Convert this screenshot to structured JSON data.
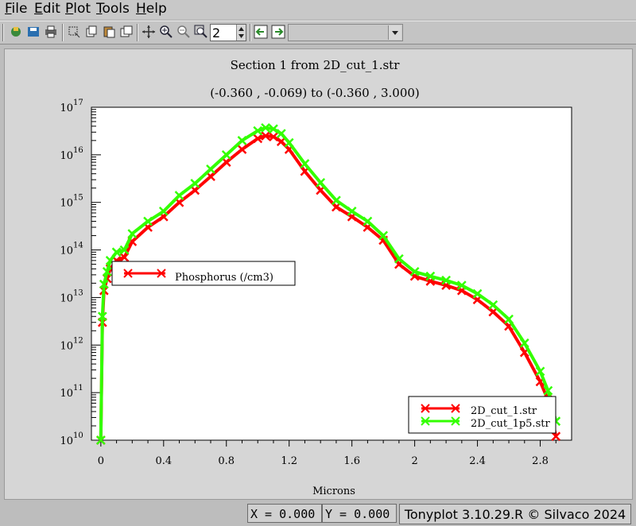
{
  "menu": {
    "file": {
      "key": "F",
      "rest": "ile"
    },
    "edit": {
      "key": "E",
      "rest": "dit"
    },
    "plot": {
      "key": "P",
      "rest": "lot"
    },
    "tools": {
      "key": "T",
      "rest": "ools"
    },
    "help": {
      "key": "H",
      "rest": "elp"
    }
  },
  "toolbar": {
    "spin_value": "2",
    "combo_value": ""
  },
  "plot": {
    "title": "Section 1 from 2D_cut_1.str",
    "subtitle": "(-0.360 , -0.069) to (-0.360 , 3.000)",
    "xlabel": "Microns",
    "x_ticks": [
      "0",
      "0.4",
      "0.8",
      "1.2",
      "1.6",
      "2",
      "2.4",
      "2.8"
    ],
    "y_tick_base": "10",
    "y_tick_exps": [
      "17",
      "16",
      "15",
      "14",
      "13",
      "12",
      "11",
      "10"
    ],
    "quantity_legend": "Phosphorus (/cm3)",
    "file_legend": [
      "2D_cut_1.str",
      "2D_cut_1p5.str"
    ]
  },
  "colors": {
    "series1": "#ff0000",
    "series2": "#33ff00"
  },
  "chart_data": {
    "type": "line",
    "title": "Section 1 from 2D_cut_1.str",
    "subtitle": "(-0.360 , -0.069) to (-0.360 , 3.000)",
    "xlabel": "Microns",
    "ylabel": "",
    "xlim": [
      -0.06,
      3.0
    ],
    "ylim": [
      10000000000.0,
      1e+17
    ],
    "yscale": "log",
    "grid": false,
    "legend": [
      "top-left (quantity)",
      "bottom-right (files)"
    ],
    "series": [
      {
        "name": "2D_cut_1.str",
        "color": "#ff0000",
        "x": [
          0.0,
          0.01,
          0.02,
          0.04,
          0.06,
          0.1,
          0.15,
          0.2,
          0.3,
          0.4,
          0.5,
          0.6,
          0.7,
          0.8,
          0.9,
          1.0,
          1.05,
          1.1,
          1.15,
          1.2,
          1.3,
          1.4,
          1.5,
          1.6,
          1.7,
          1.8,
          1.9,
          2.0,
          2.1,
          2.2,
          2.3,
          2.4,
          2.5,
          2.6,
          2.7,
          2.8,
          2.85,
          2.9
        ],
        "y": [
          10000000000.0,
          3000000000000.0,
          14000000000000.0,
          25000000000000.0,
          40000000000000.0,
          60000000000000.0,
          70000000000000.0,
          150000000000000.0,
          300000000000000.0,
          500000000000000.0,
          1000000000000000.0,
          1800000000000000.0,
          3500000000000000.0,
          7000000000000000.0,
          1.3e+16,
          2.2e+16,
          2.5e+16,
          2.4e+16,
          1.9e+16,
          1.3e+16,
          4500000000000000.0,
          1800000000000000.0,
          800000000000000.0,
          500000000000000.0,
          300000000000000.0,
          160000000000000.0,
          50000000000000.0,
          28000000000000.0,
          22000000000000.0,
          18000000000000.0,
          14000000000000.0,
          9000000000000.0,
          5000000000000.0,
          2500000000000.0,
          700000000000.0,
          170000000000.0,
          70000000000.0,
          12000000000.0
        ]
      },
      {
        "name": "2D_cut_1p5.str",
        "color": "#33ff00",
        "x": [
          0.0,
          0.01,
          0.02,
          0.04,
          0.06,
          0.1,
          0.15,
          0.2,
          0.3,
          0.4,
          0.5,
          0.6,
          0.7,
          0.8,
          0.9,
          1.0,
          1.05,
          1.1,
          1.15,
          1.2,
          1.3,
          1.4,
          1.5,
          1.6,
          1.7,
          1.8,
          1.9,
          2.0,
          2.1,
          2.2,
          2.3,
          2.4,
          2.5,
          2.6,
          2.7,
          2.8,
          2.85,
          2.9
        ],
        "y": [
          10000000000.0,
          4000000000000.0,
          19000000000000.0,
          35000000000000.0,
          60000000000000.0,
          90000000000000.0,
          100000000000000.0,
          220000000000000.0,
          400000000000000.0,
          650000000000000.0,
          1400000000000000.0,
          2500000000000000.0,
          5000000000000000.0,
          1e+16,
          2e+16,
          3.2e+16,
          3.7e+16,
          3.5e+16,
          2.8e+16,
          1.8e+16,
          6500000000000000.0,
          2600000000000000.0,
          1100000000000000.0,
          650000000000000.0,
          400000000000000.0,
          200000000000000.0,
          65000000000000.0,
          35000000000000.0,
          28000000000000.0,
          23000000000000.0,
          18000000000000.0,
          12000000000000.0,
          7000000000000.0,
          3500000000000.0,
          1100000000000.0,
          280000000000.0,
          110000000000.0,
          25000000000.0
        ]
      }
    ]
  }
}
